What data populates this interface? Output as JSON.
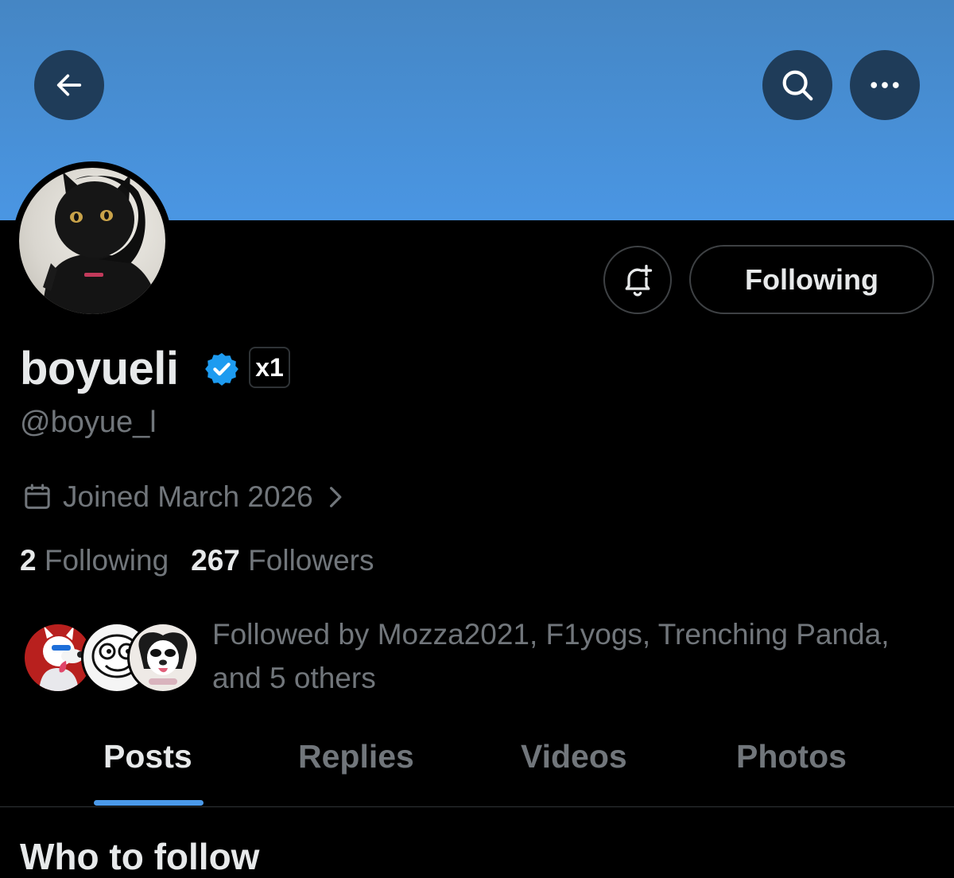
{
  "header": {
    "back_icon": "arrow-left-icon",
    "search_icon": "search-icon",
    "more_icon": "more-horizontal-icon",
    "banner_color": "#4a96e3"
  },
  "profile": {
    "avatar_alt": "black cat avatar",
    "notify_icon": "bell-plus-icon",
    "follow_button_label": "Following",
    "display_name": "boyueli",
    "verified_icon": "verified-badge-icon",
    "affiliation_badge": "x1",
    "handle": "@boyue_l",
    "joined_icon": "calendar-icon",
    "joined_text": "Joined March 2026",
    "joined_chevron": "chevron-right-icon",
    "following_count": "2",
    "following_label": "Following",
    "followers_count": "267",
    "followers_label": "Followers",
    "followed_by_text": "Followed by Mozza2021, F1yogs, Trenching Panda, and 5 others"
  },
  "tabs": [
    {
      "label": "Posts",
      "active": true
    },
    {
      "label": "Replies",
      "active": false
    },
    {
      "label": "Videos",
      "active": false
    },
    {
      "label": "Photos",
      "active": false
    }
  ],
  "sections": {
    "who_to_follow": "Who to follow"
  },
  "colors": {
    "accent": "#4a99e9",
    "verified": "#1d9bf0",
    "muted_text": "#71767b",
    "primary_text": "#e7e9ea"
  }
}
